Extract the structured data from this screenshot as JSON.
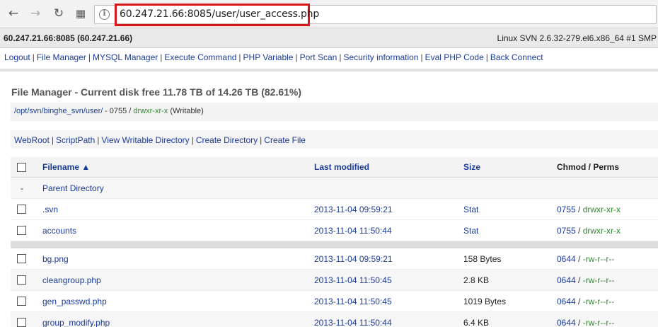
{
  "browser": {
    "url": "60.247.21.66:8085/user/user_access.php",
    "back_icon": "←",
    "forward_icon": "→",
    "reload_icon": "↻",
    "apps_icon": "▦",
    "info_icon": "i"
  },
  "server": {
    "host": "60.247.21.66:8085 (60.247.21.66)",
    "os": "Linux SVN 2.6.32-279.el6.x86_64 #1 SMP"
  },
  "menu": [
    "Logout",
    "File Manager",
    "MYSQL Manager",
    "Execute Command",
    "PHP Variable",
    "Port Scan",
    "Security information",
    "Eval PHP Code",
    "Back Connect"
  ],
  "file_manager": {
    "title": "File Manager - Current disk free 11.78 TB of 14.26 TB (82.61%)",
    "path": "/opt/svn/binghe_svn/user/",
    "mode_prefix": " - 0755 / ",
    "perm": "drwxr-xr-x",
    "writable": " (Writable)",
    "actions": [
      "WebRoot",
      "ScriptPath",
      "View Writable Directory",
      "Create Directory",
      "Create File"
    ]
  },
  "table": {
    "headers": {
      "filename": "Filename ▲",
      "modified": "Last modified",
      "size": "Size",
      "perms": "Chmod / Perms"
    },
    "parent": {
      "dash": "-",
      "label": "Parent Directory"
    },
    "dirs": [
      {
        "name": ".svn",
        "modified": "2013-11-04 09:59:21",
        "size": "Stat",
        "octal": "0755",
        "perm": "drwxr-xr-x"
      },
      {
        "name": "accounts",
        "modified": "2013-11-04 11:50:44",
        "size": "Stat",
        "octal": "0755",
        "perm": "drwxr-xr-x"
      }
    ],
    "files": [
      {
        "name": "bg.png",
        "modified": "2013-11-04 09:59:21",
        "size": "158 Bytes",
        "octal": "0644",
        "perm": "-rw-r--r--"
      },
      {
        "name": "cleangroup.php",
        "modified": "2013-11-04 11:50:45",
        "size": "2.8 KB",
        "octal": "0644",
        "perm": "-rw-r--r--"
      },
      {
        "name": "gen_passwd.php",
        "modified": "2013-11-04 11:50:45",
        "size": "1019 Bytes",
        "octal": "0644",
        "perm": "-rw-r--r--"
      },
      {
        "name": "group_modify.php",
        "modified": "2013-11-04 11:50:44",
        "size": "6.4 KB",
        "octal": "0644",
        "perm": "-rw-r--r--"
      }
    ]
  }
}
